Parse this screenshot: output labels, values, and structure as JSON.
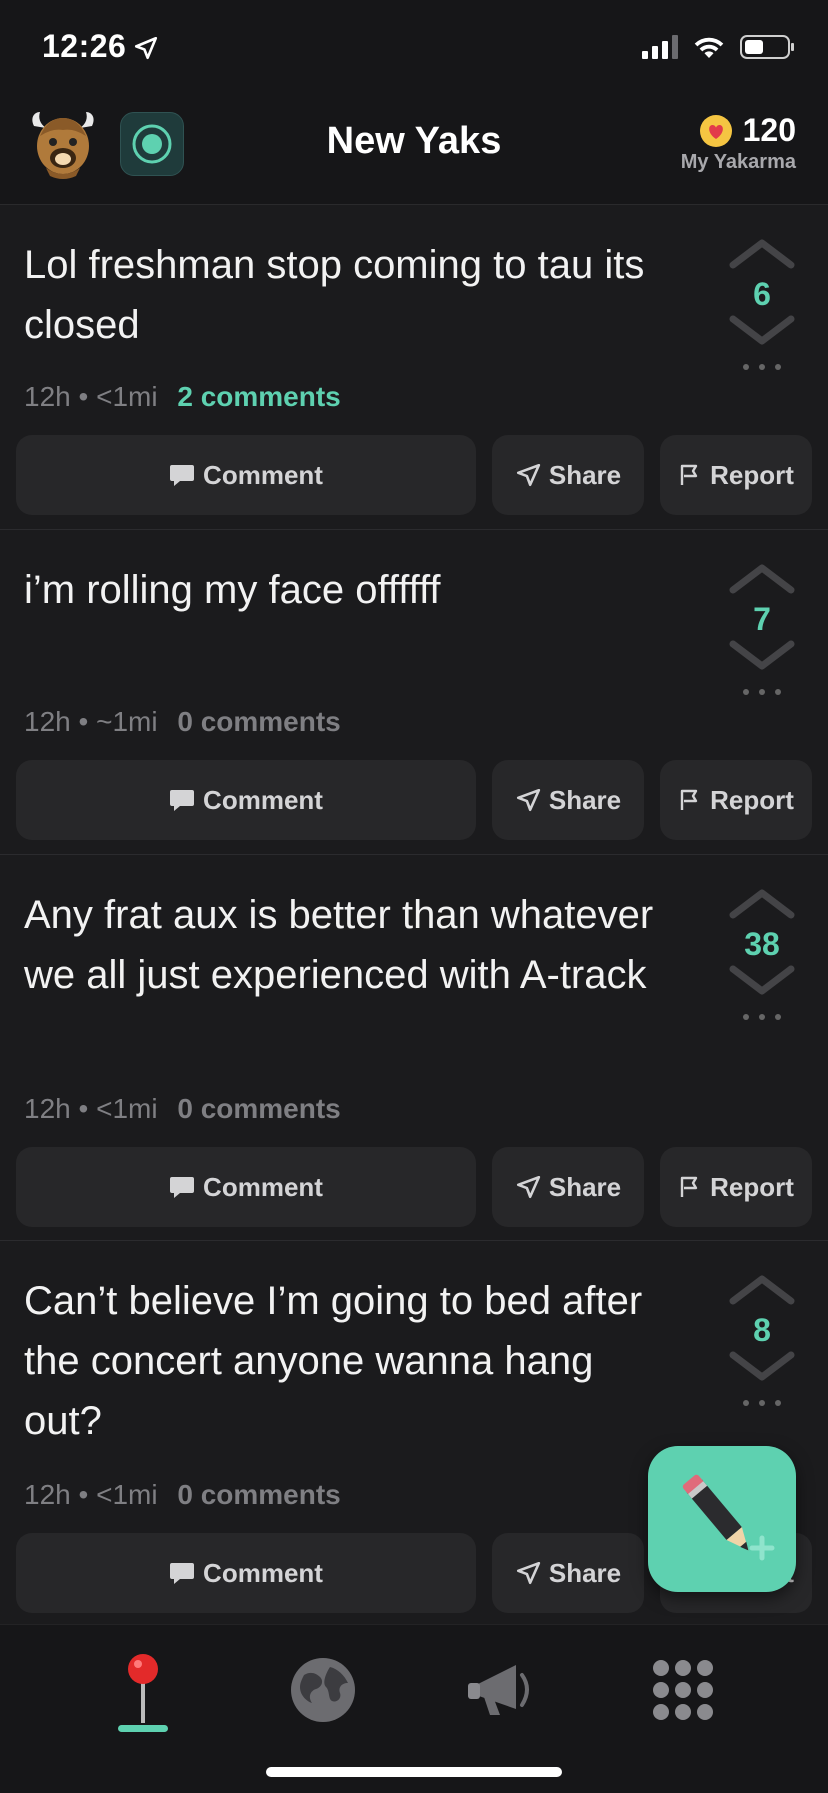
{
  "status": {
    "time": "12:26"
  },
  "header": {
    "title": "New Yaks",
    "yakarma_count": "120",
    "yakarma_label": "My Yakarma"
  },
  "posts": [
    {
      "text": "Lol freshman stop coming to tau its closed",
      "time": "12h",
      "distance": "<1mi",
      "comments": "2 comments",
      "votes": "6"
    },
    {
      "text": "i’m rolling my face offffff",
      "time": "12h",
      "distance": "~1mi",
      "comments": "0 comments",
      "votes": "7"
    },
    {
      "text": "Any frat aux is better than whatever we all just experienced with A-track",
      "time": "12h",
      "distance": "<1mi",
      "comments": "0 comments",
      "votes": "38"
    },
    {
      "text": "Can’t believe I’m going to bed after the concert anyone wanna hang out?",
      "time": "12h",
      "distance": "<1mi",
      "comments": "0 comments",
      "votes": "8"
    }
  ],
  "actions": {
    "comment": "Comment",
    "share": "Share",
    "report": "Report"
  },
  "tabs": [
    "location-pin-icon",
    "globe-icon",
    "megaphone-icon",
    "grid-icon"
  ],
  "colors": {
    "accent": "#5ed1b0",
    "background": "#1b1b1d",
    "button": "#272729"
  }
}
